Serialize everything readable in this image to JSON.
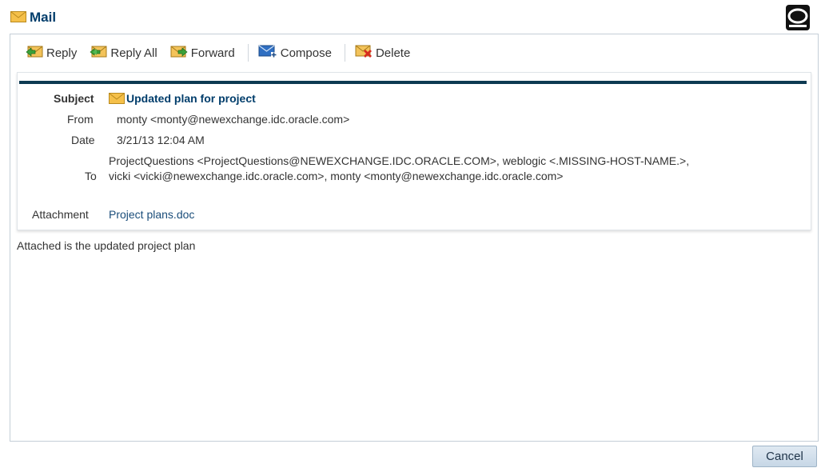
{
  "window": {
    "title": "Mail"
  },
  "toolbar": {
    "reply": "Reply",
    "reply_all": "Reply All",
    "forward": "Forward",
    "compose": "Compose",
    "delete": "Delete"
  },
  "message": {
    "subject_label": "Subject",
    "subject": "Updated plan for project",
    "from_label": "From",
    "from": "monty <monty@newexchange.idc.oracle.com>",
    "date_label": "Date",
    "date": "3/21/13 12:04 AM",
    "to_label": "To",
    "to_line1": "ProjectQuestions <ProjectQuestions@NEWEXCHANGE.IDC.ORACLE.COM>, weblogic <.MISSING-HOST-NAME.>,",
    "to_line2": "vicki <vicki@newexchange.idc.oracle.com>, monty  <monty@newexchange.idc.oracle.com>",
    "attachment_label": "Attachment",
    "attachment": "Project plans.doc",
    "body": "Attached is the updated project plan"
  },
  "actions": {
    "cancel": "Cancel"
  },
  "colors": {
    "title": "#003d6b",
    "rule": "#0d3a52",
    "accent": "#f2b635"
  }
}
